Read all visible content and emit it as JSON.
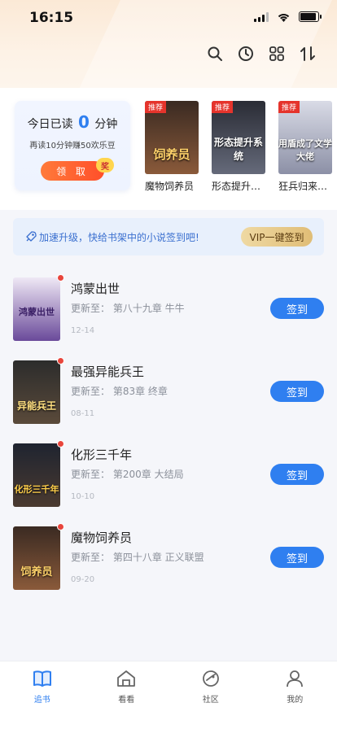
{
  "status_bar": {
    "time": "16:15"
  },
  "header": {
    "icons": [
      "search-icon",
      "history-icon",
      "grid-icon",
      "sort-icon"
    ]
  },
  "today_card": {
    "prefix": "今日已读",
    "minutes": "0",
    "suffix": "分钟",
    "subtitle": "再读10分钟赚50欢乐豆",
    "claim_label": "领 取",
    "badge": "奖"
  },
  "recommended": [
    {
      "title": "魔物饲养员",
      "tag": "推荐",
      "cover_text": "饲养员",
      "color_top": "#3a2a22",
      "color_bottom": "#8a5a3a"
    },
    {
      "title": "形态提升系统",
      "tag": "推荐",
      "cover_text": "形态提升系统",
      "color_top": "#2a2c35",
      "color_bottom": "#656a7a"
    },
    {
      "title": "狂兵归来都市",
      "tag": "推荐",
      "cover_text": "用盾成了文学大佬",
      "color_top": "#d9dbe6",
      "color_bottom": "#8c90a6"
    }
  ],
  "promo": {
    "text": "加速升级，快给书架中的小说签到吧!",
    "button_label": "VIP一键签到"
  },
  "books": [
    {
      "title": "鸿蒙出世",
      "update_label": "更新至：",
      "update": "第八十九章 牛牛",
      "date": "12-14",
      "button": "签到",
      "cover_text": "鸿蒙出世",
      "color_top": "#efe8f5",
      "color_bottom": "#6a4a9a"
    },
    {
      "title": "最强异能兵王",
      "update_label": "更新至：",
      "update": "第83章 终章",
      "date": "08-11",
      "button": "签到",
      "cover_text": "异能兵王",
      "color_top": "#2c2c2c",
      "color_bottom": "#5a4a3a"
    },
    {
      "title": "化形三千年",
      "update_label": "更新至：",
      "update": "第200章 大结局",
      "date": "10-10",
      "button": "签到",
      "cover_text": "化形三千年",
      "color_top": "#1f2430",
      "color_bottom": "#4a3a30"
    },
    {
      "title": "魔物饲养员",
      "update_label": "更新至：",
      "update": "第四十八章 正义联盟",
      "date": "09-20",
      "button": "签到",
      "cover_text": "饲养员",
      "color_top": "#3a2a22",
      "color_bottom": "#8a5a3a"
    }
  ],
  "nav": [
    {
      "label": "追书",
      "icon": "book-icon",
      "active": true
    },
    {
      "label": "看看",
      "icon": "home-icon",
      "active": false
    },
    {
      "label": "社区",
      "icon": "community-icon",
      "active": false
    },
    {
      "label": "我的",
      "icon": "profile-icon",
      "active": false
    }
  ],
  "colors": {
    "accent": "#2f7ff0",
    "orange": "#ff5a2c",
    "dot": "#e8453c"
  }
}
